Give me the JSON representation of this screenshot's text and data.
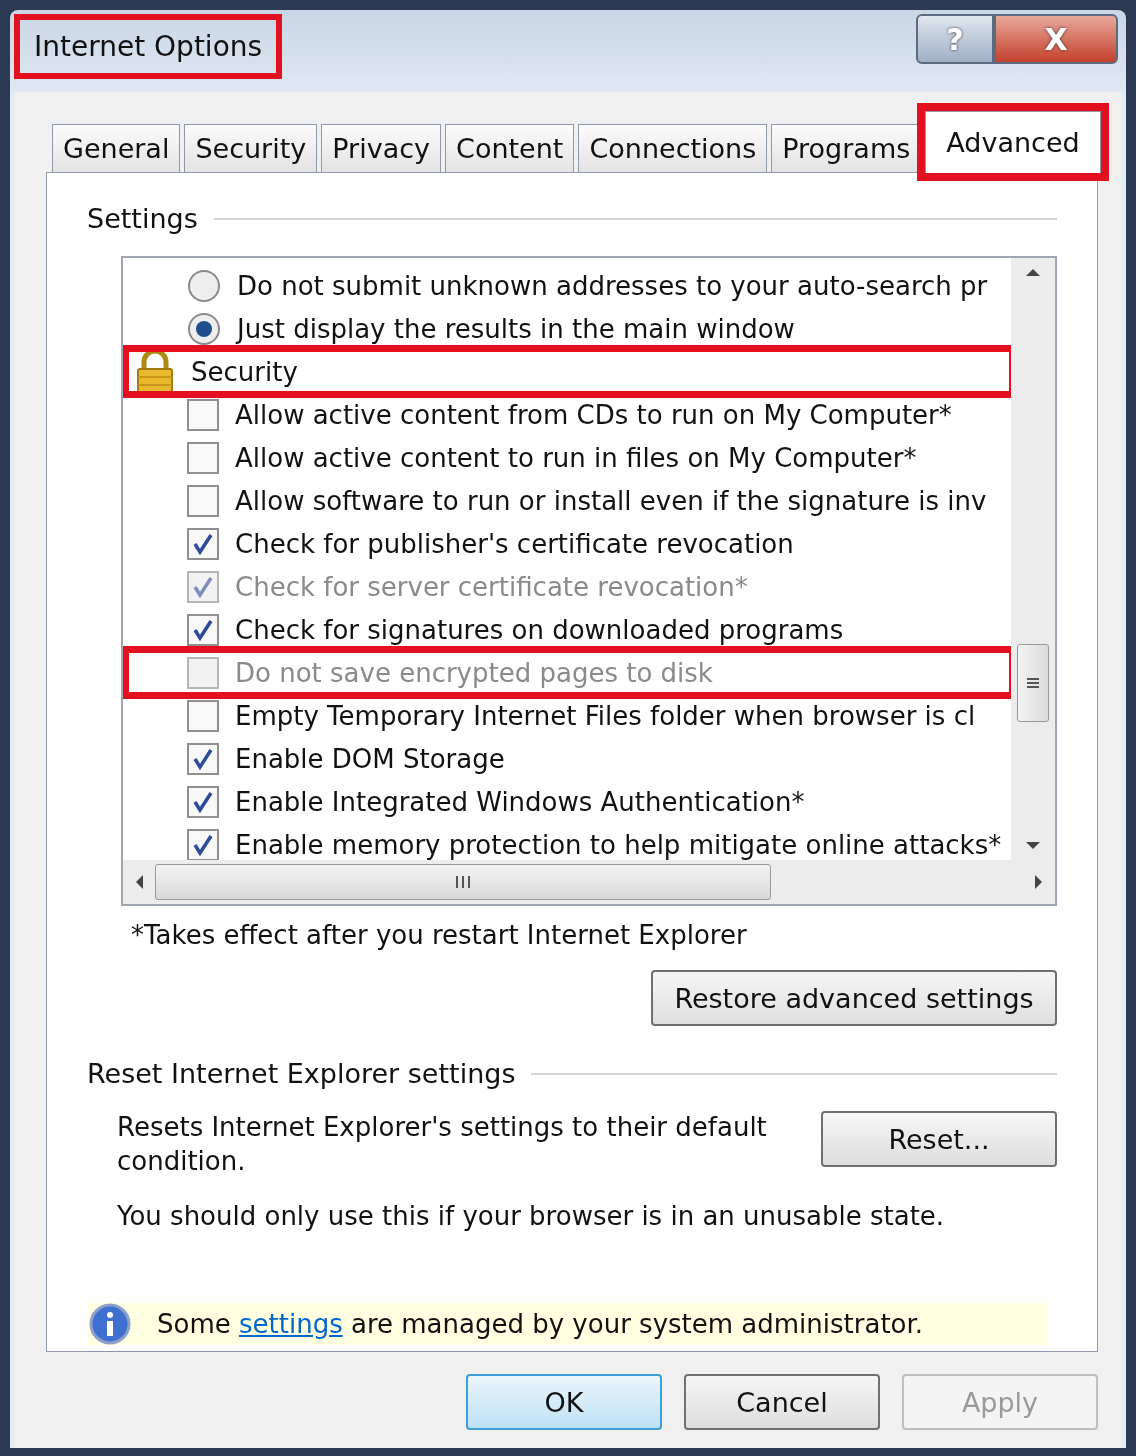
{
  "window": {
    "title": "Internet Options",
    "highlighted": true
  },
  "title_buttons": [
    {
      "kind": "help",
      "label": "?"
    },
    {
      "kind": "close",
      "label": "X"
    }
  ],
  "tabs": [
    {
      "label": "General",
      "selected": false,
      "highlighted": false
    },
    {
      "label": "Security",
      "selected": false,
      "highlighted": false
    },
    {
      "label": "Privacy",
      "selected": false,
      "highlighted": false
    },
    {
      "label": "Content",
      "selected": false,
      "highlighted": false
    },
    {
      "label": "Connections",
      "selected": false,
      "highlighted": false
    },
    {
      "label": "Programs",
      "selected": false,
      "highlighted": false
    },
    {
      "label": "Advanced",
      "selected": true,
      "highlighted": true
    }
  ],
  "settings": {
    "heading": "Settings",
    "items": [
      {
        "kind": "radio",
        "label": "Do not submit unknown addresses to your auto-search pr",
        "selected": false,
        "disabled": false,
        "highlighted": false
      },
      {
        "kind": "radio",
        "label": "Just display the results in the main window",
        "selected": true,
        "disabled": false,
        "highlighted": false
      },
      {
        "kind": "category",
        "label": "Security",
        "highlighted": true
      },
      {
        "kind": "checkbox",
        "label": "Allow active content from CDs to run on My Computer*",
        "checked": false,
        "disabled": false,
        "highlighted": false
      },
      {
        "kind": "checkbox",
        "label": "Allow active content to run in files on My Computer*",
        "checked": false,
        "disabled": false,
        "highlighted": false
      },
      {
        "kind": "checkbox",
        "label": "Allow software to run or install even if the signature is inv",
        "checked": false,
        "disabled": false,
        "highlighted": false
      },
      {
        "kind": "checkbox",
        "label": "Check for publisher's certificate revocation",
        "checked": true,
        "disabled": false,
        "highlighted": false
      },
      {
        "kind": "checkbox",
        "label": "Check for server certificate revocation*",
        "checked": true,
        "disabled": true,
        "highlighted": false
      },
      {
        "kind": "checkbox",
        "label": "Check for signatures on downloaded programs",
        "checked": true,
        "disabled": false,
        "highlighted": false
      },
      {
        "kind": "checkbox",
        "label": "Do not save encrypted pages to disk",
        "checked": false,
        "disabled": true,
        "highlighted": true
      },
      {
        "kind": "checkbox",
        "label": "Empty Temporary Internet Files folder when browser is cl",
        "checked": false,
        "disabled": false,
        "highlighted": false
      },
      {
        "kind": "checkbox",
        "label": "Enable DOM Storage",
        "checked": true,
        "disabled": false,
        "highlighted": false
      },
      {
        "kind": "checkbox",
        "label": "Enable Integrated Windows Authentication*",
        "checked": true,
        "disabled": false,
        "highlighted": false
      },
      {
        "kind": "checkbox",
        "label": "Enable memory protection to help mitigate online attacks*",
        "checked": true,
        "disabled": false,
        "highlighted": false
      }
    ],
    "note": "*Takes effect after you restart Internet Explorer",
    "restore_button": "Restore advanced settings"
  },
  "reset": {
    "heading": "Reset Internet Explorer settings",
    "description": "Resets Internet Explorer's settings to their default condition.",
    "button": "Reset...",
    "warning": "You should only use this if your browser is in an unusable state."
  },
  "info_bar": {
    "before": "Some",
    "link": "settings",
    "after": "are managed by your system administrator."
  },
  "buttons": [
    {
      "label": "OK",
      "disabled": false,
      "default": true
    },
    {
      "label": "Cancel",
      "disabled": false,
      "default": false
    },
    {
      "label": "Apply",
      "disabled": true,
      "default": false
    }
  ]
}
